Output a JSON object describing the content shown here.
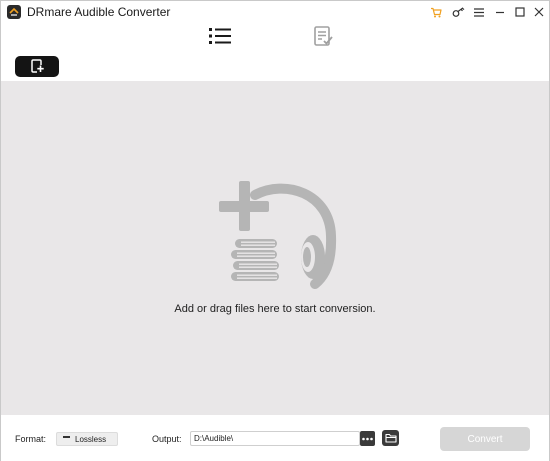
{
  "app": {
    "title": "DRmare Audible Converter"
  },
  "titlebar": {
    "controls": [
      "cart-icon",
      "key-icon",
      "menu-icon",
      "minimize-icon",
      "maximize-icon",
      "close-icon"
    ],
    "cart_color": "#f0a020"
  },
  "tabs": [
    {
      "icon": "list-icon",
      "active": true
    },
    {
      "icon": "converted-history-icon",
      "active": false
    }
  ],
  "toolbar": {
    "add_icon": "add-files-icon"
  },
  "drop_area": {
    "message": "Add or drag files here to start conversion.",
    "illustration": "add-audiobook-icon",
    "background": "#e9e7e8"
  },
  "bottom": {
    "format_label": "Format:",
    "format_value": "Lossless",
    "output_label": "Output:",
    "output_path": "D:\\Audible\\",
    "browse_icon": "more-icon",
    "folder_icon": "folder-icon",
    "convert_label": "Convert",
    "convert_color": "#d6d6d6"
  }
}
